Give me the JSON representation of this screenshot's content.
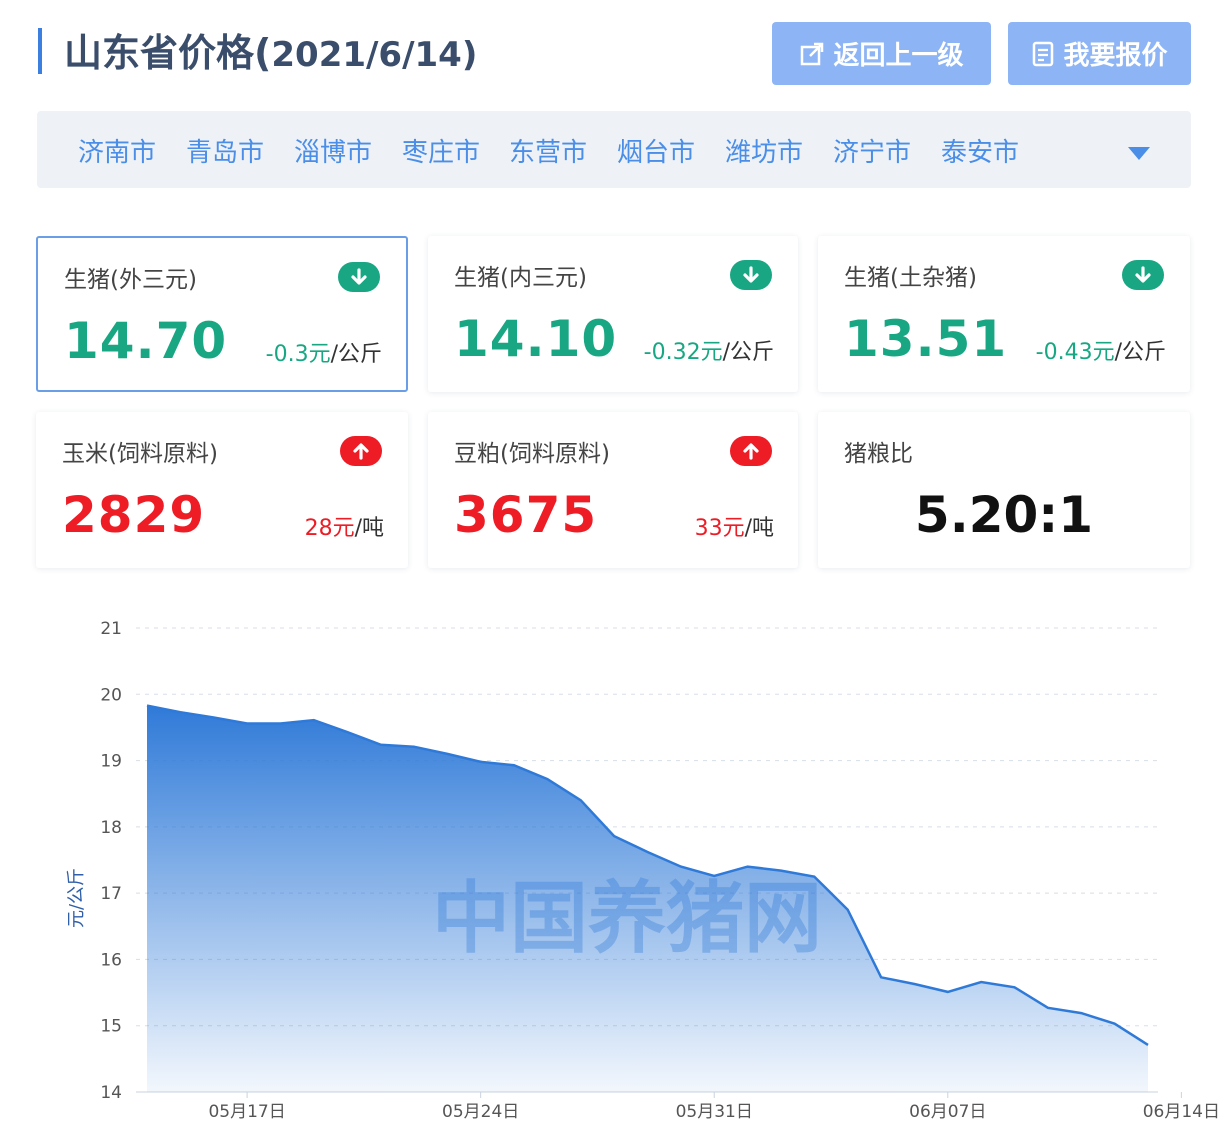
{
  "header": {
    "title": "山东省价格(",
    "date": "2021/6/14",
    "close_paren": ")",
    "back_label": "返回上一级",
    "quote_label": "我要报价",
    "colors": {
      "accent": "#3b7fe0",
      "button": "#8db4f4"
    }
  },
  "cities": [
    "济南市",
    "青岛市",
    "淄博市",
    "枣庄市",
    "东营市",
    "烟台市",
    "潍坊市",
    "济宁市",
    "泰安市"
  ],
  "cards": [
    {
      "label": "生猪(外三元)",
      "value": "14.70",
      "change": "-0.3元",
      "unit": "/公斤",
      "trend": "down",
      "icon": "arrow-down-icon"
    },
    {
      "label": "生猪(内三元)",
      "value": "14.10",
      "change": "-0.32元",
      "unit": "/公斤",
      "trend": "down",
      "icon": "arrow-down-icon"
    },
    {
      "label": "生猪(土杂猪)",
      "value": "13.51",
      "change": "-0.43元",
      "unit": "/公斤",
      "trend": "down",
      "icon": "arrow-down-icon"
    },
    {
      "label": "玉米(饲料原料)",
      "value": "2829",
      "change": "28元",
      "unit": "/吨",
      "trend": "up",
      "icon": "arrow-up-icon"
    },
    {
      "label": "豆粕(饲料原料)",
      "value": "3675",
      "change": "33元",
      "unit": "/吨",
      "trend": "up",
      "icon": "arrow-up-icon"
    },
    {
      "label": "猪粮比",
      "value": "5.20:1"
    }
  ],
  "trend_colors": {
    "down": "#19a783",
    "up": "#ee1c25"
  },
  "watermark": "中国养猪网",
  "chart_data": {
    "type": "area",
    "title": "",
    "xlabel": "",
    "ylabel": "元/公斤",
    "ylim": [
      14,
      21
    ],
    "yticks": [
      14,
      15,
      16,
      17,
      18,
      19,
      20,
      21
    ],
    "xtick_labels": [
      "05月17日",
      "05月24日",
      "05月31日",
      "06月07日",
      "06月14日"
    ],
    "x": [
      "05月14日",
      "05月15日",
      "05月16日",
      "05月17日",
      "05月18日",
      "05月19日",
      "05月20日",
      "05月21日",
      "05月22日",
      "05月23日",
      "05月24日",
      "05月25日",
      "05月26日",
      "05月27日",
      "05月28日",
      "05月29日",
      "05月30日",
      "05月31日",
      "06月01日",
      "06月02日",
      "06月03日",
      "06月04日",
      "06月05日",
      "06月06日",
      "06月07日",
      "06月08日",
      "06月09日",
      "06月10日",
      "06月11日",
      "06月12日",
      "06月13日",
      "06月14日"
    ],
    "values": [
      19.83,
      19.73,
      19.65,
      19.56,
      19.56,
      19.61,
      19.43,
      19.24,
      19.21,
      19.1,
      18.98,
      18.93,
      18.72,
      18.4,
      17.86,
      17.62,
      17.4,
      17.26,
      17.4,
      17.34,
      17.25,
      16.75,
      15.73,
      15.63,
      15.51,
      15.66,
      15.58,
      15.27,
      15.19,
      15.03,
      14.71
    ],
    "grid": true,
    "color": "#2f7ad8"
  }
}
